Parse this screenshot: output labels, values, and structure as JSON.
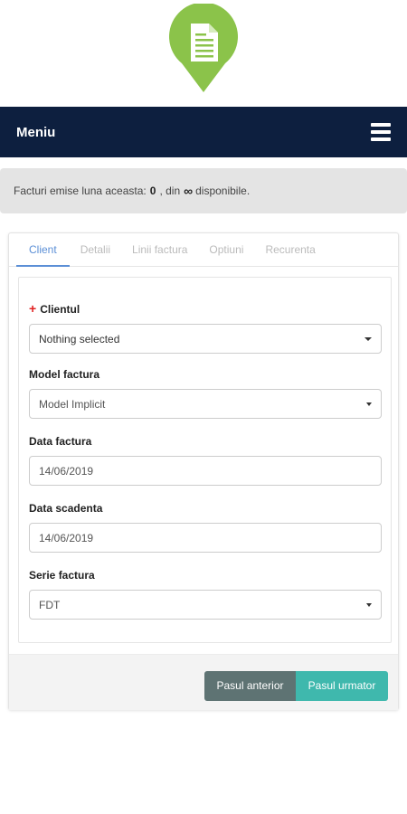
{
  "navbar": {
    "brand": "Meniu"
  },
  "info": {
    "prefix": "Facturi emise luna aceasta:",
    "count": "0",
    "middle": ", din",
    "limit": "∞",
    "suffix": "disponibile."
  },
  "tabs": [
    {
      "label": "Client",
      "active": true
    },
    {
      "label": "Detalii",
      "active": false
    },
    {
      "label": "Linii factura",
      "active": false
    },
    {
      "label": "Optiuni",
      "active": false
    },
    {
      "label": "Recurenta",
      "active": false
    }
  ],
  "form": {
    "client": {
      "required_mark": "+",
      "label": "Clientul",
      "value": "Nothing selected"
    },
    "model": {
      "label": "Model factura",
      "value": "Model Implicit"
    },
    "invoice_date": {
      "label": "Data factura",
      "value": "14/06/2019"
    },
    "due_date": {
      "label": "Data scadenta",
      "value": "14/06/2019"
    },
    "series": {
      "label": "Serie factura",
      "value": "FDT"
    }
  },
  "buttons": {
    "prev": "Pasul anterior",
    "next": "Pasul urmator"
  },
  "colors": {
    "navbar": "#0d1f3f",
    "logo": "#8bc34a",
    "accent": "#5b8fd6",
    "next_button": "#3fb8ad",
    "prev_button": "#5e7373"
  },
  "icons": {
    "logo": "document-icon",
    "menu": "hamburger-icon",
    "select": "caret-down-icon"
  }
}
